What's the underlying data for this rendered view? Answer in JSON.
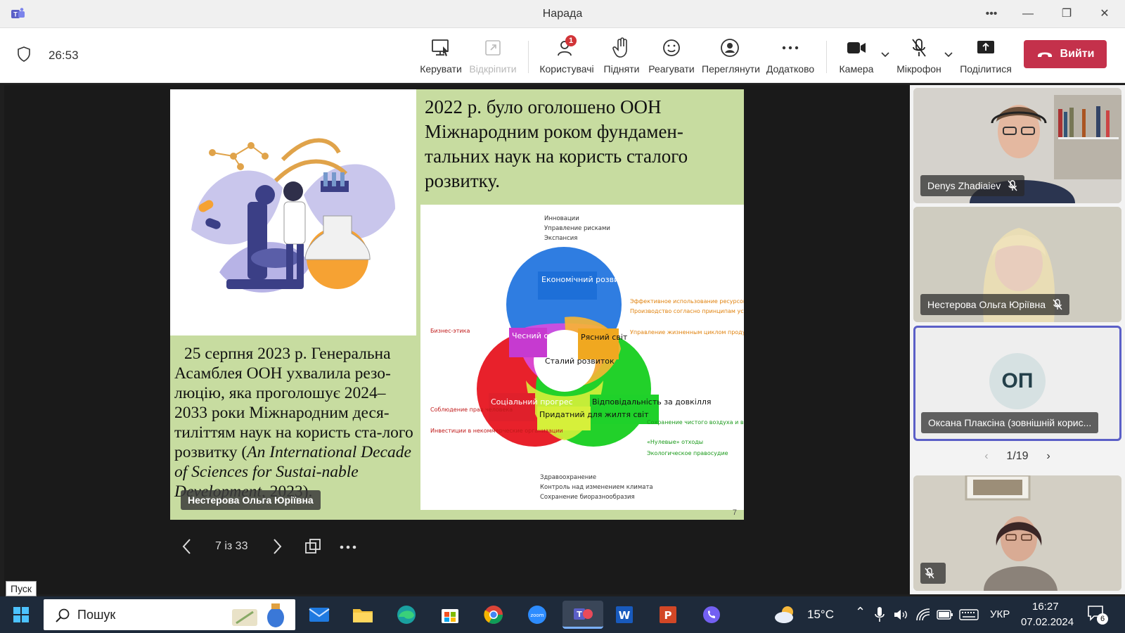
{
  "window": {
    "title": "Нарада"
  },
  "meeting": {
    "timer": "26:53",
    "tools": [
      {
        "label": "Керувати"
      },
      {
        "label": "Відкріпити"
      },
      {
        "label": "Користувачі",
        "badge": "1"
      },
      {
        "label": "Підняти"
      },
      {
        "label": "Реагувати"
      },
      {
        "label": "Переглянути"
      },
      {
        "label": "Додатково"
      },
      {
        "label": "Камера"
      },
      {
        "label": "Мікрофон"
      },
      {
        "label": "Поділитися"
      }
    ],
    "leave_label": "Вийти",
    "leave_color": "#c4314b"
  },
  "slide": {
    "title": "2022 р. було оголошено ООН Міжнародним роком фундамен-тальних наук на користь сталого розвитку.",
    "body_prefix": "25 серпня 2023 р. Генеральна Асамблея ООН ухвалила резо-люцію, яка проголошує 2024–2033 роки Міжнародним деся-тиліттям наук на користь ста-лого розвитку (",
    "body_italic": "An International Decade of Sciences for Sustai-nable Development",
    "body_suffix": ", 2023).",
    "number": "7",
    "speaker": "Нестерова Ольга Юріївна",
    "background_color": "#c7dca0",
    "diagram": {
      "top_bullets": [
        "Инновации",
        "Управление рисками",
        "Экспансия"
      ],
      "right_bullets": [
        "Эффективное использование ресурсов",
        "Производство согласно принципам устойчивого развития",
        "Управление жизненным циклом продуктов"
      ],
      "left_bullet": "Бизнес-этика",
      "left_bottom_bullets": [
        "Соблюдение прав человека",
        "Инвестиции в некоммерческие организации"
      ],
      "right_bottom_bullets": [
        "Сохранение чистого воздуха и воды",
        "«Нулевые» отходы",
        "Экологическое правосудие"
      ],
      "bottom_bullets": [
        "Здравоохранение",
        "Контроль над изменением климата",
        "Сохранение биоразнообразия"
      ],
      "circle_economic": "Економічний розвиток",
      "circle_social": "Соціальний прогрес",
      "circle_env": "Відповідальність за довкілля",
      "overlap_honest": "Чесний світ",
      "overlap_bright": "Рясний світ",
      "overlap_livable": "Придатний для жилтя світ",
      "center": "Сталий розвиток"
    }
  },
  "slide_nav": {
    "page": "7 із 33"
  },
  "start_tooltip": "Пуск",
  "participants": [
    {
      "name": "Denys Zhadiaiev"
    },
    {
      "name": "Нестерова Ольга Юріївна"
    },
    {
      "name": "Оксана Плаксіна (зовнішній корис...",
      "initials": "ОП"
    },
    {
      "name": ""
    }
  ],
  "pager": "1/19",
  "taskbar": {
    "search_placeholder": "Пошук",
    "weather": "15°C",
    "lang": "УКР",
    "time": "16:27",
    "date": "07.02.2024",
    "notifications": "6"
  }
}
